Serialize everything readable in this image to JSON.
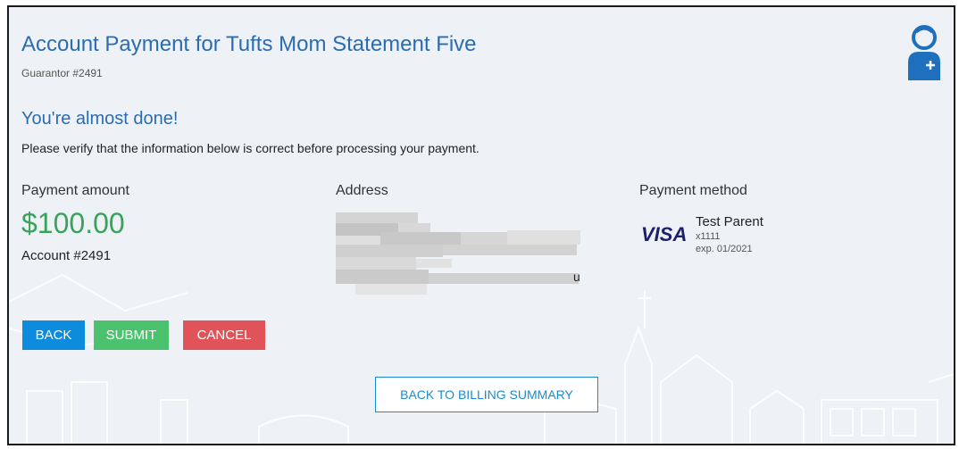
{
  "header": {
    "title": "Account Payment for Tufts Mom Statement Five",
    "guarantor": "Guarantor #2491",
    "avatar_icon": "user-avatar-icon"
  },
  "confirm": {
    "heading": "You're almost done!",
    "instructions": "Please verify that the information below is correct before processing your payment."
  },
  "payment_amount": {
    "label": "Payment amount",
    "value": "$100.00",
    "account": "Account #2491"
  },
  "address": {
    "label": "Address",
    "visible_tail": "u"
  },
  "payment_method": {
    "label": "Payment method",
    "brand": "VISA",
    "name": "Test Parent",
    "last_digits": "x1111",
    "expiry": "exp. 01/2021"
  },
  "actions": {
    "back": "BACK",
    "submit": "SUBMIT",
    "cancel": "CANCEL",
    "back_to_billing": "BACK TO BILLING SUMMARY"
  },
  "colors": {
    "title_blue": "#2b6cb0",
    "amount_green": "#3aa35b",
    "back_blue": "#0d8bdc",
    "submit_green": "#4cc26e",
    "cancel_red": "#e05358",
    "visa_navy": "#1a1f71"
  }
}
